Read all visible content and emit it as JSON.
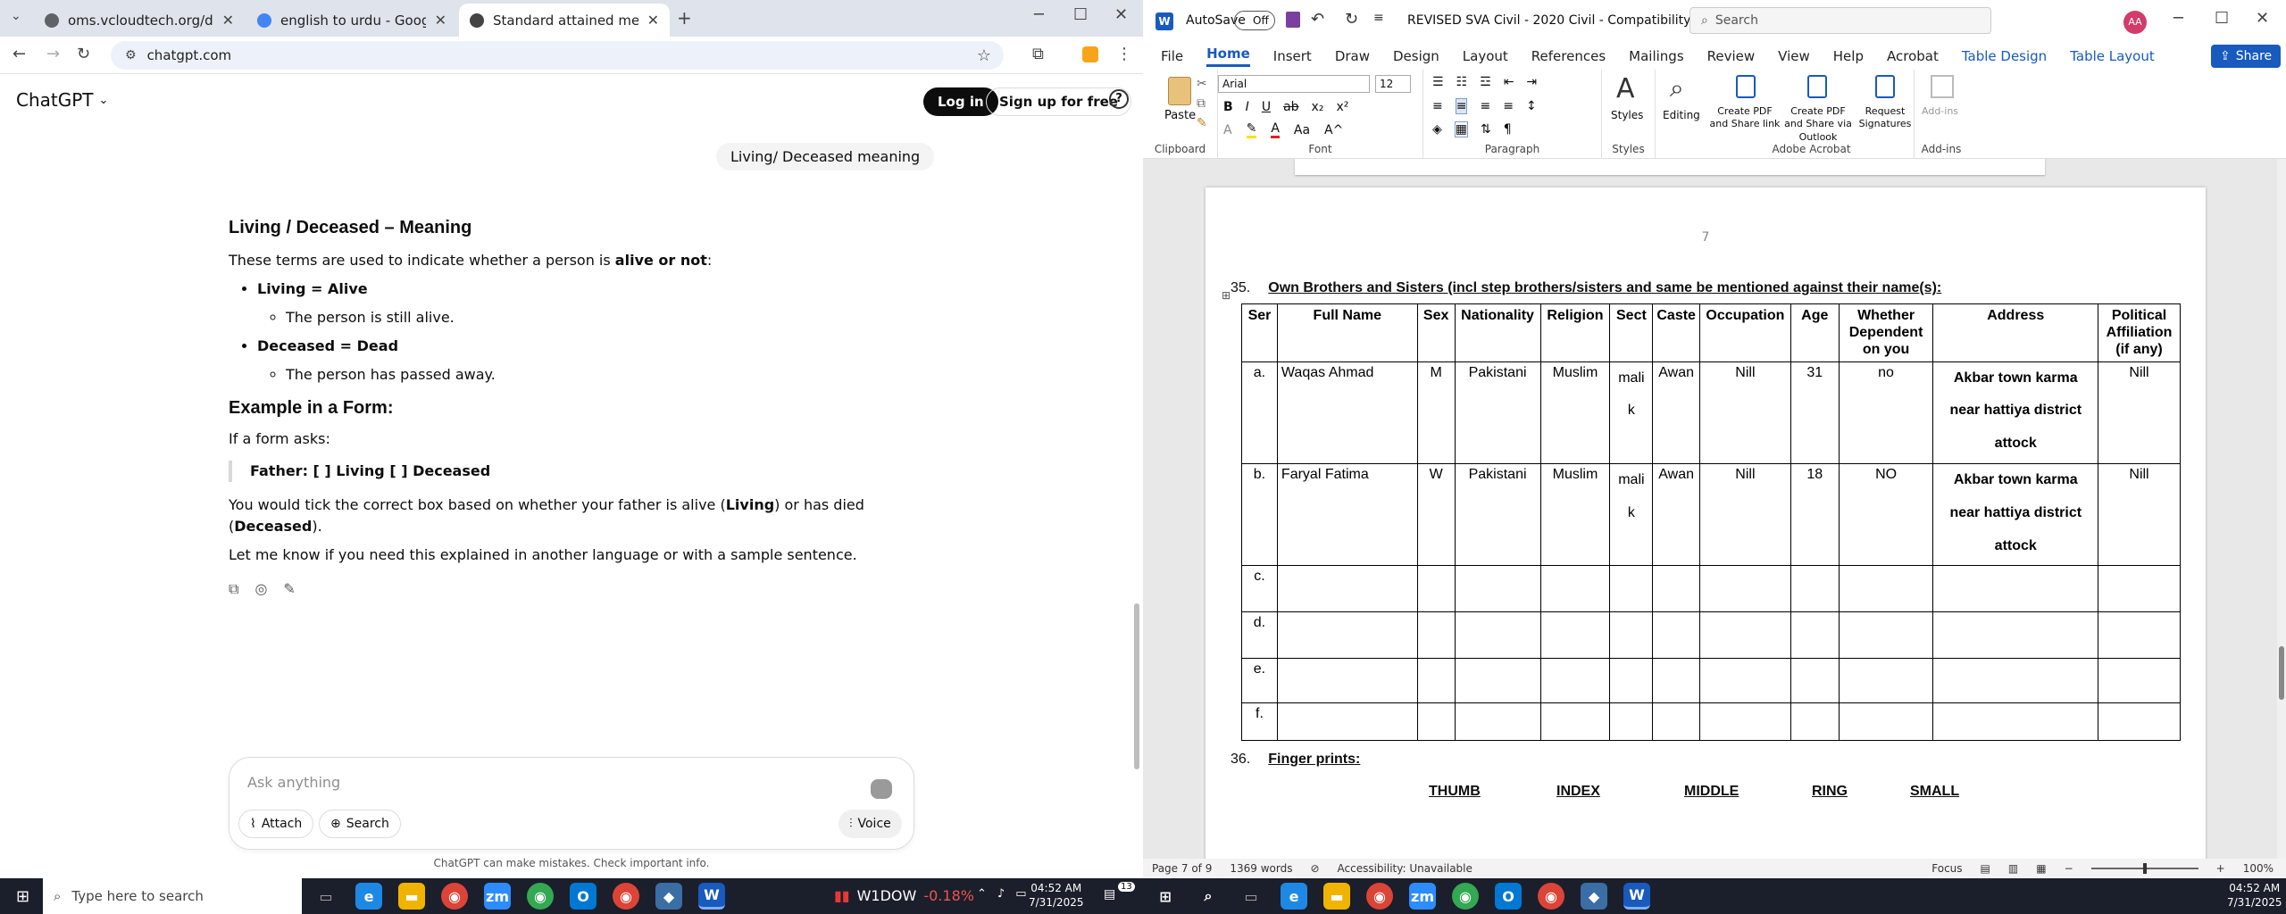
{
  "browser": {
    "tabs": [
      {
        "title": "oms.vcloudtech.org/dashboard",
        "color": "#5f6368"
      },
      {
        "title": "english to urdu - Google Search",
        "color": "#4285f4"
      },
      {
        "title": "Standard attained meaning",
        "color": "#444444"
      }
    ],
    "url": "chatgpt.com"
  },
  "chatgpt": {
    "brand": "ChatGPT",
    "login": "Log in",
    "signup": "Sign up for free",
    "user_message": "Living/ Deceased  meaning",
    "heading1": "Living / Deceased – Meaning",
    "intro_pre": "These terms are used to indicate whether a person is ",
    "intro_bold": "alive or not",
    "intro_post": ":",
    "bullet1_bold": "Living = Alive",
    "bullet1_sub": "The person is still alive.",
    "bullet2_bold": "Deceased = Dead",
    "bullet2_sub": "The person has passed away.",
    "heading2": "Example in a Form:",
    "form_intro": "If a form asks:",
    "quote": "Father: [ ] Living [ ] Deceased",
    "para_pre": "You would tick the correct box based on whether your father is alive (",
    "para_living": "Living",
    "para_mid": ") or has died (",
    "para_deceased": "Deceased",
    "para_post": ").",
    "closing": "Let me know if you need this explained in another language or with a sample sentence.",
    "input_placeholder": "Ask anything",
    "attach": "Attach",
    "search": "Search",
    "voice": "Voice",
    "disclaimer": "ChatGPT can make mistakes. Check important info."
  },
  "word": {
    "autosave": "AutoSave",
    "autosave_state": "Off",
    "doc_title": "REVISED SVA Civil - 2020 Civil  -  Compatibility...",
    "search_placeholder": "Search",
    "avatar": "AA",
    "share": "Share",
    "ribbon_tabs": [
      "File",
      "Home",
      "Insert",
      "Draw",
      "Design",
      "Layout",
      "References",
      "Mailings",
      "Review",
      "View",
      "Help",
      "Acrobat",
      "Table Design",
      "Table Layout"
    ],
    "font_name": "Arial",
    "font_size": "12",
    "groups": {
      "clipboard": "Clipboard",
      "font": "Font",
      "paragraph": "Paragraph",
      "styles": "Styles",
      "adobe": "Adobe Acrobat",
      "addins": "Add-ins"
    },
    "buttons": {
      "paste": "Paste",
      "styles": "Styles",
      "editing": "Editing",
      "pdf_share": "Create PDF and Share link",
      "pdf_outlook": "Create PDF and Share via Outlook",
      "signatures": "Request Signatures",
      "addins": "Add-ins"
    },
    "page_number": "7",
    "section35_num": "35.",
    "section35_title": "Own Brothers and Sisters (incl step brothers/sisters and same be mentioned against their name(s):",
    "table_headers": [
      "Ser",
      "Full Name",
      "Sex",
      "Nationality",
      "Religion",
      "Sect",
      "Caste",
      "Occupation",
      "Age",
      "Whether Dependent on you",
      "Address",
      "Political Affiliation (if any)"
    ],
    "rows": [
      {
        "ser": "a.",
        "name": "Waqas Ahmad",
        "sex": "M",
        "nat": "Pakistani",
        "rel": "Muslim",
        "sect": "mali k",
        "caste": "Awan",
        "occ": "Nill",
        "age": "31",
        "dep": "no",
        "addr": "Akbar town karma near hattiya district attock",
        "pol": "Nill"
      },
      {
        "ser": "b.",
        "name": "Faryal Fatima",
        "sex": "W",
        "nat": "Pakistani",
        "rel": "Muslim",
        "sect": "mali k",
        "caste": "Awan",
        "occ": "Nill",
        "age": "18",
        "dep": "NO",
        "addr": "Akbar town karma near hattiya district attock",
        "pol": "Nill"
      },
      {
        "ser": "c."
      },
      {
        "ser": "d."
      },
      {
        "ser": "e."
      },
      {
        "ser": "f."
      }
    ],
    "section36_num": "36.",
    "section36_title": "Finger prints:",
    "fingers": [
      "THUMB",
      "INDEX",
      "MIDDLE",
      "RING",
      "SMALL"
    ],
    "status": {
      "page": "Page 7 of 9",
      "words": "1369 words",
      "accessibility": "Accessibility: Unavailable",
      "focus": "Focus",
      "zoom": "100%"
    }
  },
  "taskbar": {
    "search_placeholder": "Type here to search",
    "stock_name": "W1DOW",
    "stock_change": "-0.18%",
    "time": "04:52 AM",
    "date": "7/31/2025",
    "notif_count": "13"
  }
}
